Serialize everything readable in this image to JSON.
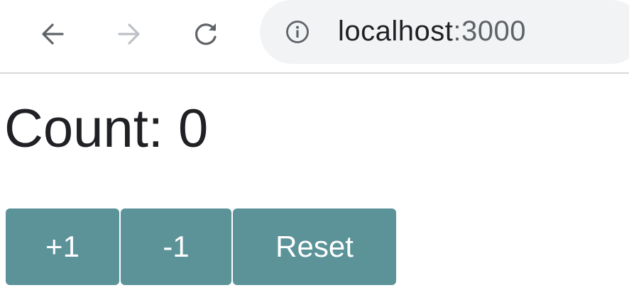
{
  "browser": {
    "icons": {
      "back": "arrow-left-icon",
      "forward": "arrow-right-icon",
      "reload": "reload-icon",
      "site_info": "info-icon"
    },
    "url_host": "localhost",
    "url_port": ":3000"
  },
  "page": {
    "count_label": "Count: 0",
    "buttons": {
      "increment": "+1",
      "decrement": "-1",
      "reset": "Reset"
    }
  },
  "colors": {
    "button_bg": "#5b9399",
    "button_text": "#ffffff",
    "omnibox_bg": "#f1f3f4"
  }
}
